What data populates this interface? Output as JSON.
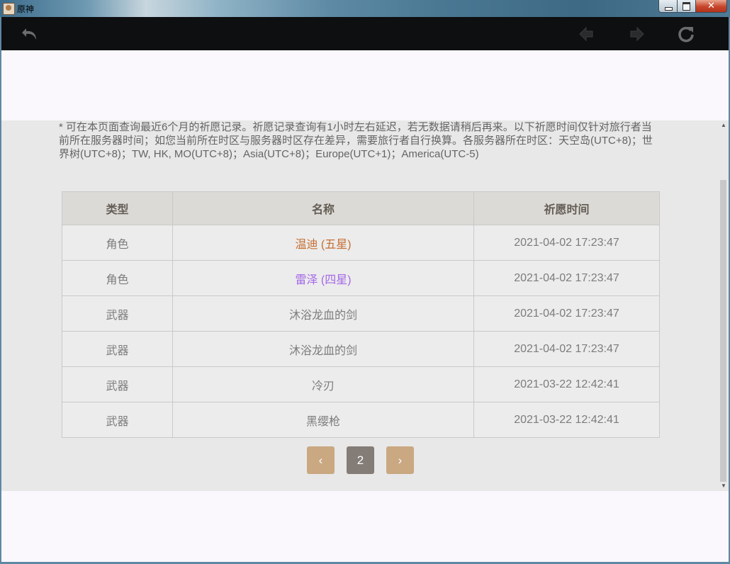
{
  "window": {
    "title": "原神",
    "close_glyph": "✕"
  },
  "icons": {
    "back": "undo-arrow-icon",
    "prev": "left-arrow-icon",
    "next": "right-arrow-icon",
    "reload": "reload-icon"
  },
  "notice": "* 可在本页面查询最近6个月的祈愿记录。祈愿记录查询有1小时左右延迟，若无数据请稍后再来。以下祈愿时间仅针对旅行者当前所在服务器时间；如您当前所在时区与服务器时区存在差异，需要旅行者自行换算。各服务器所在时区：天空岛(UTC+8)；世界树(UTC+8)；TW, HK, MO(UTC+8)；Asia(UTC+8)；Europe(UTC+1)；America(UTC-5)",
  "table": {
    "headers": [
      "类型",
      "名称",
      "祈愿时间"
    ],
    "rows": [
      {
        "type": "角色",
        "name": "温迪 (五星)",
        "time": "2021-04-02 17:23:47",
        "color": "#c66e31"
      },
      {
        "type": "角色",
        "name": "雷泽 (四星)",
        "time": "2021-04-02 17:23:47",
        "color": "#a468e8"
      },
      {
        "type": "武器",
        "name": "沐浴龙血的剑",
        "time": "2021-04-02 17:23:47",
        "color": "#7c7c7c"
      },
      {
        "type": "武器",
        "name": "沐浴龙血的剑",
        "time": "2021-04-02 17:23:47",
        "color": "#7c7c7c"
      },
      {
        "type": "武器",
        "name": "冷刃",
        "time": "2021-03-22 12:42:41",
        "color": "#7c7c7c"
      },
      {
        "type": "武器",
        "name": "黑缨枪",
        "time": "2021-03-22 12:42:41",
        "color": "#7c7c7c"
      }
    ]
  },
  "pager": {
    "prev": "‹",
    "current": "2",
    "next": "›"
  },
  "scrollbar": {
    "up": "▲",
    "down": "▼"
  },
  "colors": {
    "five_star": "#c66e31",
    "four_star": "#a468e8",
    "pager_button": "#c9a882",
    "pager_current": "#847c76"
  }
}
